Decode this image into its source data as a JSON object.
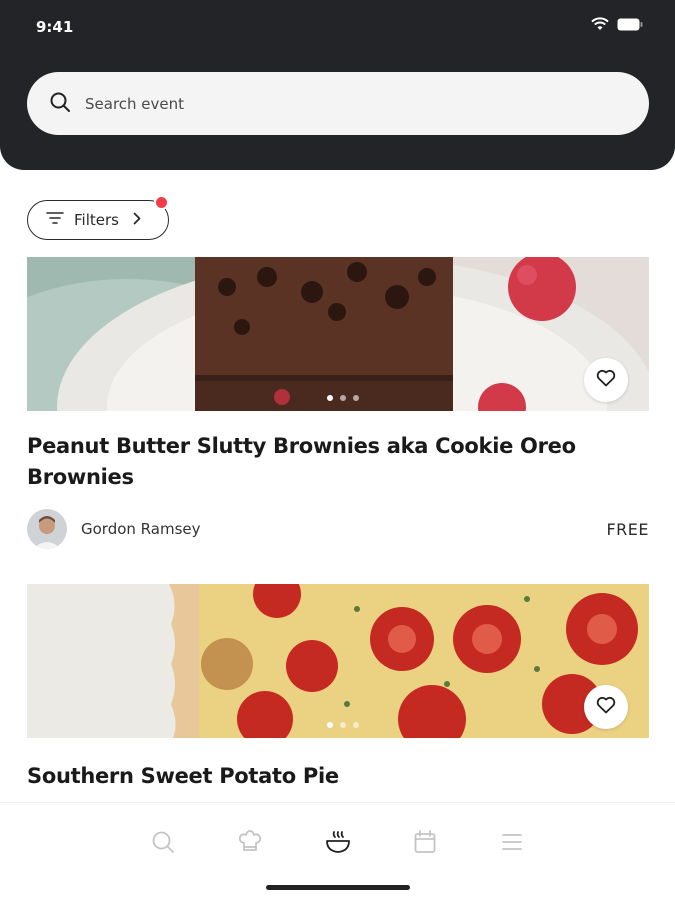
{
  "status_bar": {
    "time": "9:41"
  },
  "search": {
    "placeholder": "Search event"
  },
  "filters": {
    "label": "Filters",
    "has_notification": true
  },
  "events": [
    {
      "title": "Peanut Butter Slutty Brownies aka Cookie Oreo Brownies",
      "host": "Gordon Ramsey",
      "price": "FREE",
      "image_pages": 3,
      "active_page": 1
    },
    {
      "title": "Southern Sweet Potato Pie",
      "image_pages": 3,
      "active_page": 1
    }
  ],
  "tabbar": {
    "items": [
      {
        "icon": "search-icon"
      },
      {
        "icon": "chef-hat-icon"
      },
      {
        "icon": "bowl-icon",
        "active": true
      },
      {
        "icon": "calendar-icon"
      },
      {
        "icon": "menu-icon"
      }
    ]
  },
  "colors": {
    "header_bg": "#222427",
    "notification": "#ef3e4a",
    "tab_active": "#222222",
    "tab_inactive": "#c4c4c4"
  }
}
